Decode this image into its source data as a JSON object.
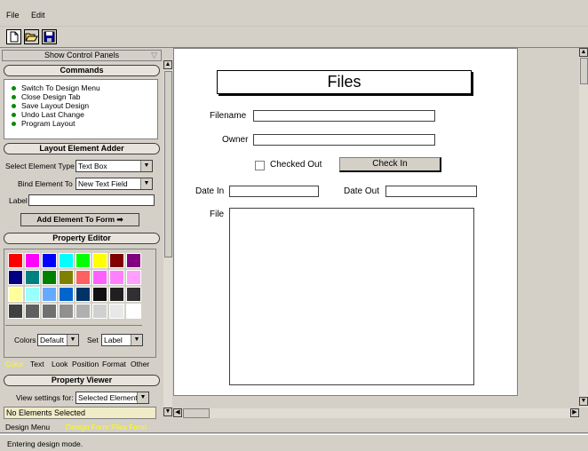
{
  "menu": {
    "file": "File",
    "edit": "Edit"
  },
  "toolbar": {
    "new_icon": "new-document-icon",
    "open_icon": "open-folder-icon",
    "save_icon": "save-disk-icon"
  },
  "left_panel": {
    "show_control_panels": "Show Control Panels",
    "commands": {
      "title": "Commands",
      "items": [
        "Switch To Design Menu",
        "Close Design Tab",
        "Save Layout Design",
        "Undo Last Change",
        "Program Layout"
      ]
    },
    "layout_adder": {
      "title": "Layout Element Adder",
      "select_type_label": "Select Element Type",
      "select_type_value": "Text Box",
      "bind_label": "Bind Element To",
      "bind_value": "New Text Field",
      "label_label": "Label",
      "label_value": "",
      "add_button": "Add Element To Form"
    },
    "property_editor": {
      "title": "Property Editor",
      "colors_label": "Colors",
      "colors_value": "Default",
      "set_label": "Set",
      "set_value": "Label",
      "swatches": [
        "#ff0000",
        "#ff00ff",
        "#0000ff",
        "#00ffff",
        "#00ff00",
        "#ffff00",
        "#800000",
        "#800080",
        "#000080",
        "#008080",
        "#008000",
        "#808000",
        "#ff6060",
        "#ff60ff",
        "#ff80ff",
        "#ffa0ff",
        "#ffff99",
        "#99ffff",
        "#66aaff",
        "#0066cc",
        "#003366",
        "#101010",
        "#202020",
        "#303030",
        "#404040",
        "#606060",
        "#707070",
        "#909090",
        "#b0b0b0",
        "#d0d0d0",
        "#e8e8e8",
        "#ffffff"
      ],
      "tabs": [
        "Color",
        "Text",
        "Look",
        "Position",
        "Format",
        "Other"
      ]
    },
    "property_viewer": {
      "title": "Property Viewer",
      "view_label": "View settings for:",
      "view_value": "Selected Elements",
      "status": "No Elements Selected"
    }
  },
  "bottom_tabs": [
    "Design Menu",
    "Design Form Files Form"
  ],
  "status_bar": "Entering design mode.",
  "form": {
    "title": "Files",
    "filename_label": "Filename",
    "owner_label": "Owner",
    "checked_out_label": "Checked Out",
    "check_in_button": "Check In",
    "date_in_label": "Date In",
    "date_out_label": "Date Out",
    "file_label": "File"
  }
}
